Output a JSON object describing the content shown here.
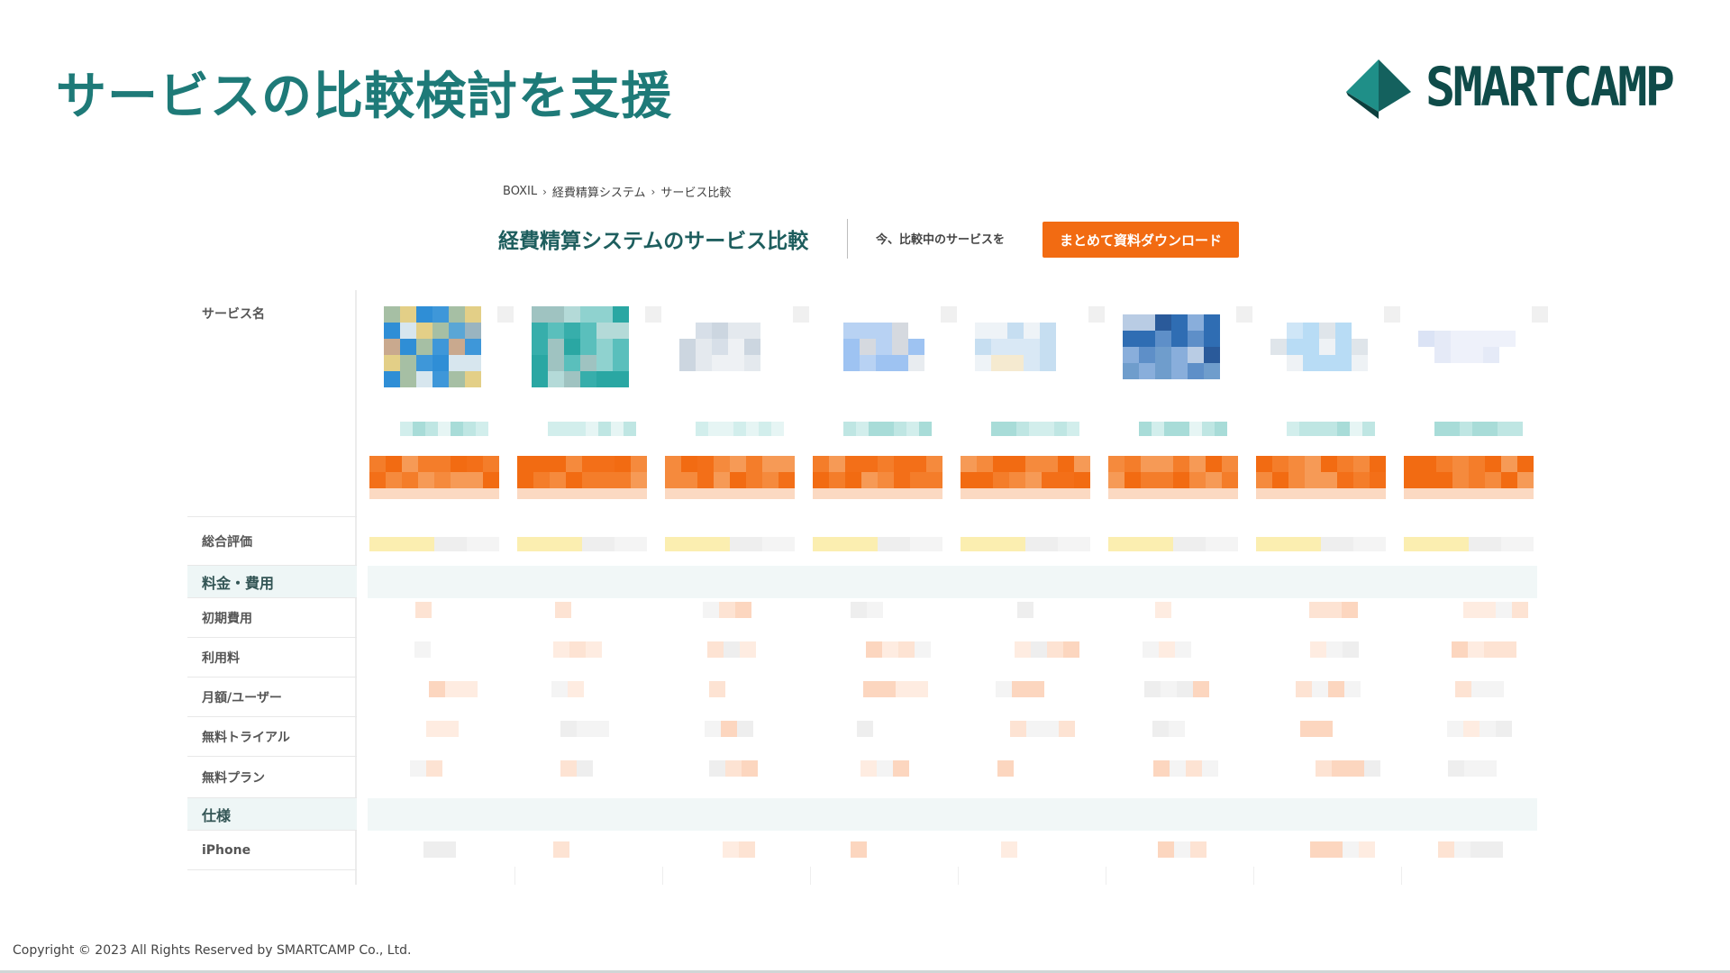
{
  "slide": {
    "title": "サービスの比較検討を支援",
    "logo_text": "SMARTCAMP",
    "copyright": "Copyright © 2023 All Rights Reserved by SMARTCAMP Co., Ltd."
  },
  "breadcrumb": [
    {
      "label": "BOXIL"
    },
    {
      "label": "経費精算システム"
    },
    {
      "label": "サービス比較"
    }
  ],
  "breadcrumb_separator": "›",
  "header": {
    "title": "経費精算システムのサービス比較",
    "now_label": "今、比較中のサービスを",
    "download_button": "まとめて資料ダウンロード"
  },
  "table": {
    "rows": [
      {
        "label": "サービス名"
      },
      {
        "label": "総合評価"
      },
      {
        "label": "料金・費用"
      },
      {
        "label": "初期費用"
      },
      {
        "label": "利用料"
      },
      {
        "label": "月額/ユーザー"
      },
      {
        "label": "無料トライアル"
      },
      {
        "label": "無料プラン"
      },
      {
        "label": "仕様"
      },
      {
        "label": "iPhone"
      }
    ]
  },
  "colors": {
    "accent_teal": "#1e7a78",
    "logo_dark": "#0f4b49",
    "cta_orange": "#f26b12"
  }
}
